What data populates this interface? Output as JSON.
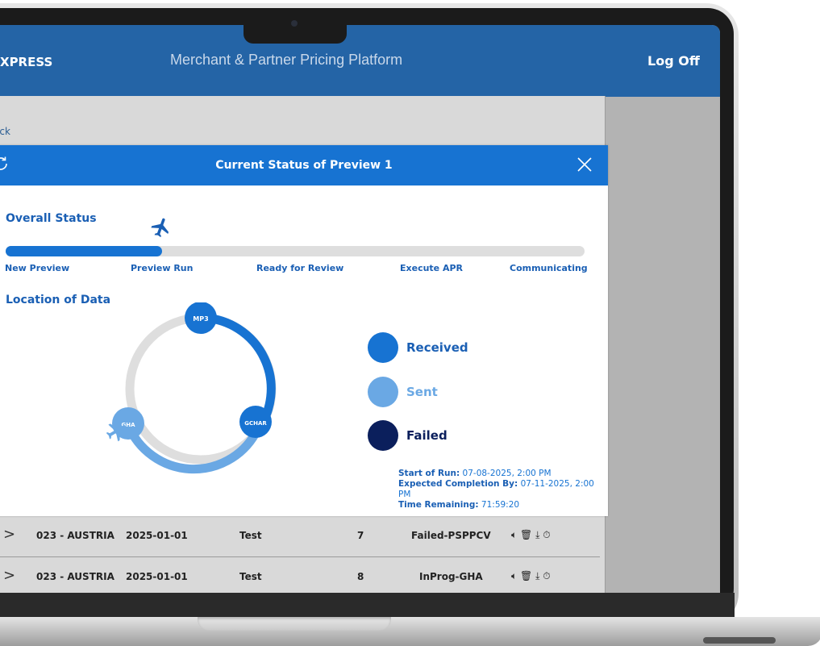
{
  "app": {
    "brand": "XPRESS",
    "title": "Merchant & Partner Pricing Platform",
    "logoff": "Log Off",
    "back": "ack"
  },
  "modal": {
    "title": "Current Status of Preview 1",
    "overall_status_heading": "Overall Status",
    "location_heading": "Location of Data",
    "progress_fraction": 0.27,
    "stages": [
      "New Preview",
      "Preview Run",
      "Ready for Review",
      "Execute APR",
      "Communicating"
    ],
    "nodes": [
      "MP3",
      "GCHAR",
      "GHA"
    ],
    "legend": [
      {
        "label": "Received",
        "color": "#1773d2"
      },
      {
        "label": "Sent",
        "color": "#6aa8e4"
      },
      {
        "label": "Failed",
        "color": "#0b1f5c"
      }
    ],
    "run": {
      "start_label": "Start of Run:",
      "start_value": "07-08-2025, 2:00 PM",
      "expected_label": "Expected Completion By:",
      "expected_value": "07-11-2025, 2:00 PM",
      "remaining_label": "Time Remaining:",
      "remaining_value": "71:59:20"
    }
  },
  "table": {
    "rows": [
      {
        "country": "023 - AUSTRIA",
        "date": "2025-01-01",
        "name": "Test",
        "num": "7",
        "status": "Failed-PSPPCV"
      },
      {
        "country": "023 - AUSTRIA",
        "date": "2025-01-01",
        "name": "Test",
        "num": "8",
        "status": "InProg-GHA"
      }
    ]
  },
  "colors": {
    "header_blue": "#2464a6",
    "modal_blue": "#1773d2",
    "light_blue": "#6aa8e4",
    "navy": "#0b1f5c"
  },
  "icons": [
    "refresh-icon",
    "close-icon",
    "airplane-icon",
    "speaker-icon",
    "trash-icon",
    "download-icon",
    "timer-icon",
    "chevron-right-icon"
  ]
}
